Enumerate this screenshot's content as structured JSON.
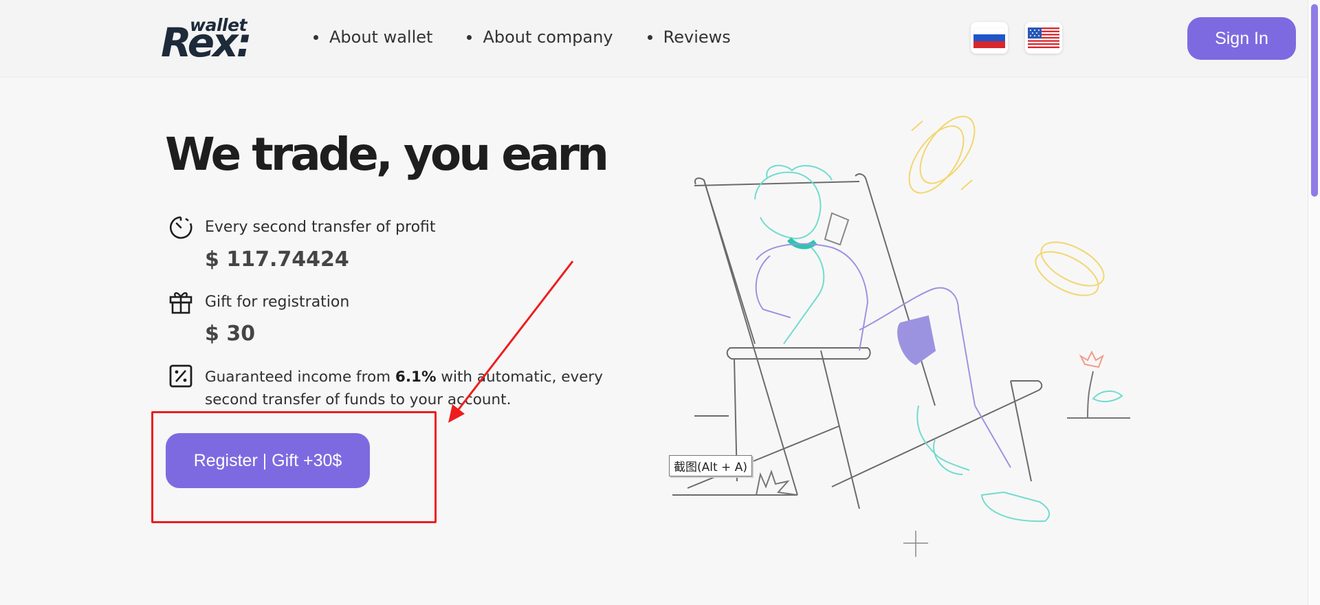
{
  "header": {
    "logo_small": "wallet",
    "logo_big": "Rex:",
    "nav": [
      "About wallet",
      "About company",
      "Reviews"
    ],
    "languages": [
      "russian-flag-icon",
      "usa-flag-icon"
    ],
    "sign_in": "Sign In"
  },
  "hero": {
    "title": "We trade, you earn",
    "features": [
      {
        "icon": "clock-icon",
        "label": "Every second transfer of profit",
        "value": "$ 117.74424"
      },
      {
        "icon": "gift-icon",
        "label": "Gift for registration",
        "value": "$ 30"
      }
    ],
    "income": {
      "icon": "percent-icon",
      "pre": "Guaranteed income from ",
      "rate": "6.1%",
      "post": " with automatic, every second transfer of funds to your account."
    },
    "register_button": "Register | Gift +30$"
  },
  "overlay": {
    "tooltip": "截图(Alt + A)"
  },
  "colors": {
    "accent": "#7e6ae0",
    "annotation": "#ee1d1d",
    "coin": "#f2d670",
    "person": "#6fdcce",
    "pants": "#9b93e0"
  }
}
